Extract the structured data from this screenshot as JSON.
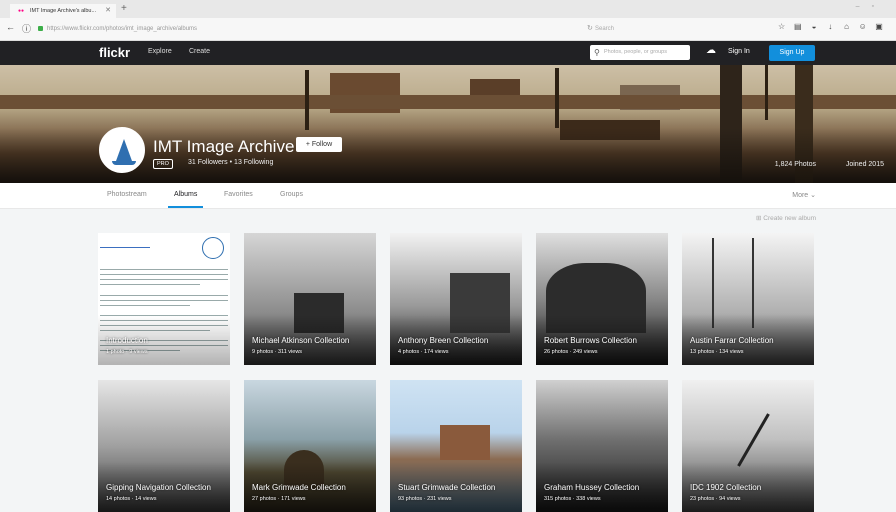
{
  "browser": {
    "tab_title": "IMT Image Archive's albu...",
    "url": "https://www.flickr.com/photos/imt_image_archive/albums",
    "search_placeholder": "Search"
  },
  "header": {
    "logo": "flickr",
    "explore": "Explore",
    "create": "Create",
    "search_placeholder": "Photos, people, or groups",
    "sign_in": "Sign In",
    "sign_up": "Sign Up"
  },
  "profile": {
    "name": "IMT Image Archive",
    "follow_label": "+ Follow",
    "pro_badge": "PRO",
    "followers": "31 Followers",
    "following": "13 Following",
    "separator": "•",
    "photos": "1,824 Photos",
    "joined": "Joined 2015"
  },
  "subnav": {
    "tabs": [
      {
        "label": "Photostream"
      },
      {
        "label": "Albums"
      },
      {
        "label": "Favorites"
      },
      {
        "label": "Groups"
      }
    ],
    "more": "More ⌄"
  },
  "create_album": "Create new album",
  "albums": [
    {
      "title": "Introduction",
      "photos": "1 photo",
      "views": "9 views"
    },
    {
      "title": "Michael Atkinson Collection",
      "photos": "9 photos",
      "views": "311 views"
    },
    {
      "title": "Anthony Breen Collection",
      "photos": "4 photos",
      "views": "174 views"
    },
    {
      "title": "Robert Burrows Collection",
      "photos": "26 photos",
      "views": "249 views"
    },
    {
      "title": "Austin Farrar Collection",
      "photos": "13 photos",
      "views": "134 views"
    },
    {
      "title": "Gipping Navigation Collection",
      "photos": "14 photos",
      "views": "14 views"
    },
    {
      "title": "Mark Grimwade Collection",
      "photos": "27 photos",
      "views": "171 views"
    },
    {
      "title": "Stuart Grimwade Collection",
      "photos": "93 photos",
      "views": "231 views"
    },
    {
      "title": "Graham Hussey Collection",
      "photos": "315 photos",
      "views": "338 views"
    },
    {
      "title": "IDC 1902 Collection",
      "photos": "23 photos",
      "views": "94 views"
    }
  ],
  "colors": {
    "accent": "#128fdc",
    "header_bg": "#212124"
  }
}
